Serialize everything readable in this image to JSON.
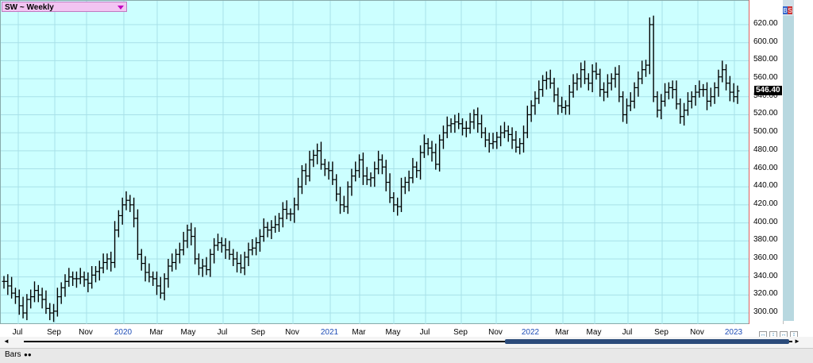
{
  "header": {
    "symbol_title": "SW ~ Weekly"
  },
  "price_axis": {
    "ticks": [
      "620.00",
      "600.00",
      "580.00",
      "560.00",
      "540.00",
      "520.00",
      "500.00",
      "480.00",
      "460.00",
      "440.00",
      "420.00",
      "400.00",
      "380.00",
      "360.00",
      "340.00",
      "320.00",
      "300.00"
    ],
    "last_price": "546.40"
  },
  "time_axis": {
    "labels": [
      {
        "text": "Jul",
        "year": false
      },
      {
        "text": "Sep",
        "year": false
      },
      {
        "text": "Nov",
        "year": false
      },
      {
        "text": "2020",
        "year": true
      },
      {
        "text": "Mar",
        "year": false
      },
      {
        "text": "May",
        "year": false
      },
      {
        "text": "Jul",
        "year": false
      },
      {
        "text": "Sep",
        "year": false
      },
      {
        "text": "Nov",
        "year": false
      },
      {
        "text": "2021",
        "year": true
      },
      {
        "text": "Mar",
        "year": false
      },
      {
        "text": "May",
        "year": false
      },
      {
        "text": "Jul",
        "year": false
      },
      {
        "text": "Sep",
        "year": false
      },
      {
        "text": "Nov",
        "year": false
      },
      {
        "text": "2022",
        "year": true
      },
      {
        "text": "Mar",
        "year": false
      },
      {
        "text": "May",
        "year": false
      },
      {
        "text": "Jul",
        "year": false
      },
      {
        "text": "Sep",
        "year": false
      },
      {
        "text": "Nov",
        "year": false
      },
      {
        "text": "2023",
        "year": true
      }
    ]
  },
  "footer": {
    "bars_label": "Bars"
  },
  "colors": {
    "plot_bg": "#ccffff",
    "bar_color": "#000000",
    "grid": "#a8e0e8",
    "year_label": "#1e4db7",
    "symbol_bg": "#f2c4f2"
  },
  "chart_data": {
    "type": "ohlc",
    "title": "SW ~ Weekly",
    "ylim": [
      285,
      635
    ],
    "grid": true,
    "series": [
      {
        "values": [
          335,
          330,
          322,
          318,
          308,
          300,
          315,
          318,
          325,
          320,
          315,
          305,
          300,
          302,
          318,
          328,
          335,
          340,
          338,
          338,
          340,
          337,
          333,
          342,
          346,
          350,
          356,
          360,
          356,
          392,
          408,
          420,
          425,
          420,
          405,
          365,
          355,
          345,
          340,
          338,
          330,
          322,
          338,
          352,
          356,
          365,
          370,
          380,
          392,
          385,
          360,
          350,
          352,
          348,
          365,
          375,
          378,
          375,
          370,
          365,
          360,
          355,
          350,
          362,
          370,
          372,
          378,
          385,
          395,
          392,
          395,
          398,
          405,
          415,
          410,
          410,
          420,
          440,
          458,
          452,
          470,
          475,
          480,
          465,
          460,
          458,
          448,
          432,
          420,
          418,
          440,
          452,
          458,
          470,
          452,
          448,
          450,
          460,
          470,
          462,
          445,
          428,
          420,
          418,
          440,
          445,
          450,
          462,
          458,
          478,
          488,
          483,
          478,
          465,
          492,
          500,
          508,
          510,
          512,
          510,
          505,
          505,
          512,
          520,
          510,
          500,
          492,
          488,
          490,
          495,
          500,
          502,
          498,
          492,
          484,
          488,
          500,
          520,
          530,
          538,
          548,
          558,
          560,
          555,
          542,
          530,
          528,
          530,
          545,
          555,
          560,
          570,
          560,
          555,
          568,
          565,
          548,
          545,
          555,
          560,
          565,
          540,
          520,
          530,
          535,
          550,
          560,
          570,
          575,
          620,
          540,
          525,
          535,
          545,
          550,
          548,
          532,
          518,
          525,
          535,
          540,
          545,
          548,
          548,
          535,
          540,
          550,
          562,
          570,
          555,
          545,
          540,
          546.4
        ]
      }
    ]
  }
}
